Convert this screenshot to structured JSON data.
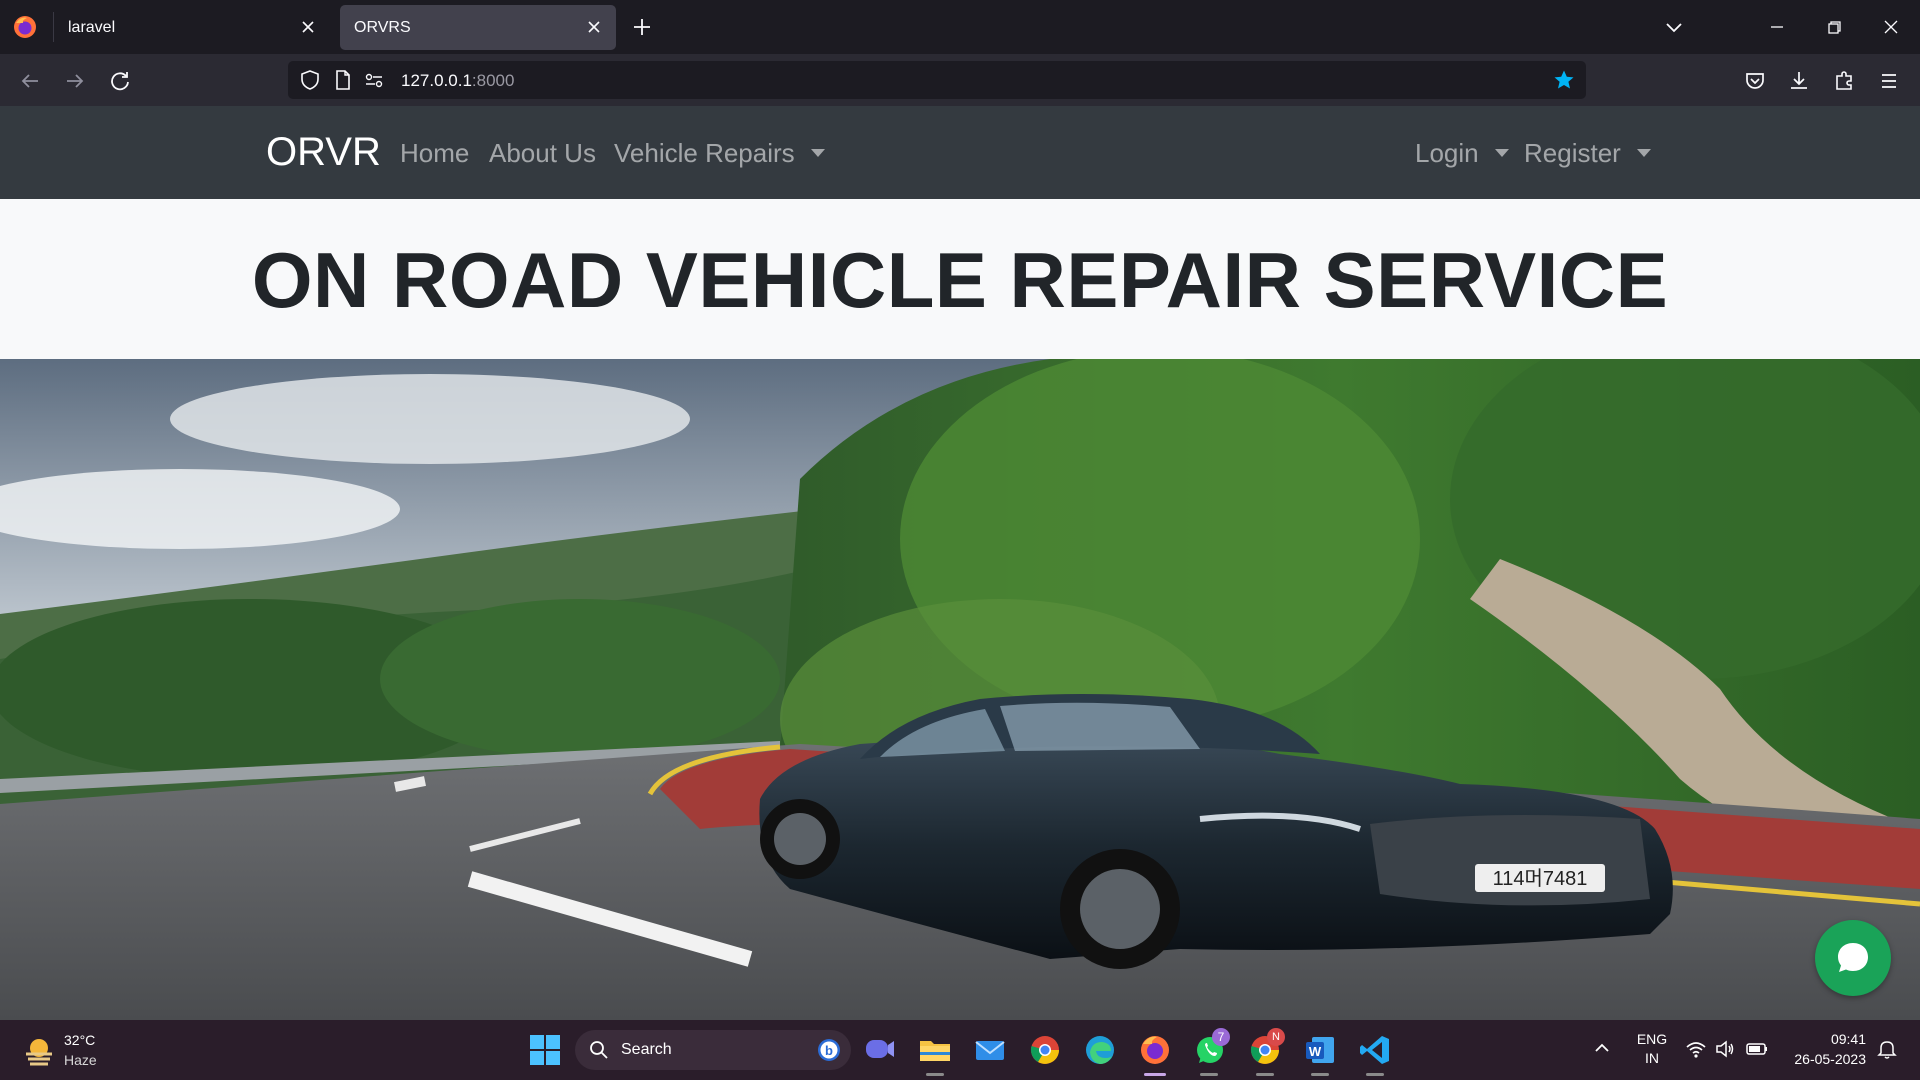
{
  "browser": {
    "tabs": [
      {
        "title": "laravel",
        "active": false
      },
      {
        "title": "ORVRS",
        "active": true
      }
    ],
    "url": {
      "host": "127.0.0.1",
      "port": ":8000"
    },
    "accent": "#00b3f4"
  },
  "site": {
    "brand": "ORVR",
    "nav": {
      "home": "Home",
      "about": "About Us",
      "repairs": "Vehicle Repairs",
      "login": "Login",
      "register": "Register"
    },
    "hero_title": "ON ROAD VEHICLE REPAIR SERVICE",
    "license_plate": "114머7481",
    "colors": {
      "navbar": "#343a40",
      "chat": "#1aa358"
    }
  },
  "taskbar": {
    "weather": {
      "temp": "32°C",
      "condition": "Haze"
    },
    "search_label": "Search",
    "badges": {
      "whatsapp": "7",
      "chrome_profile": "N"
    },
    "tray": {
      "lang_top": "ENG",
      "lang_bottom": "IN",
      "time": "09:41",
      "date": "26-05-2023"
    }
  }
}
